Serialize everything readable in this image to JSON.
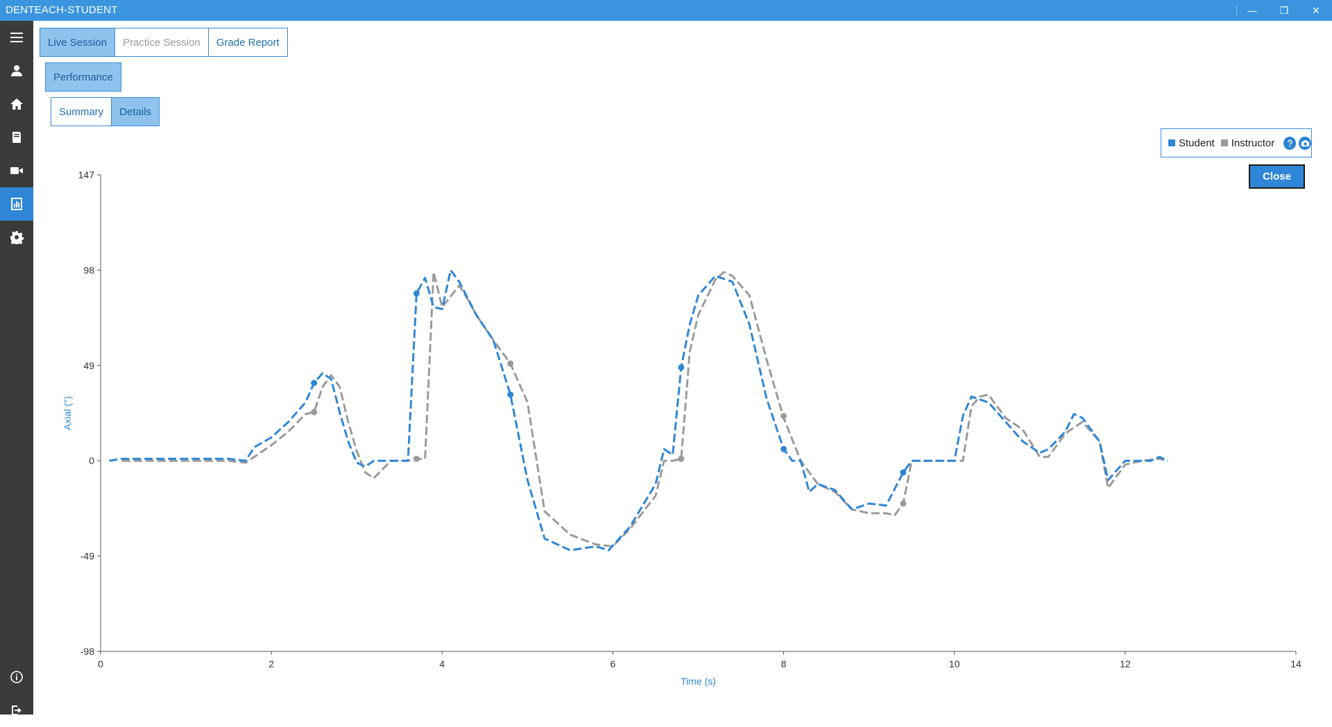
{
  "window": {
    "title": "DENTEACH-STUDENT",
    "minimize_glyph": "—",
    "restore_glyph": "❐",
    "close_glyph": "✕"
  },
  "sidebar": {
    "items": [
      {
        "icon": "hamburger-menu-icon",
        "active": false
      },
      {
        "icon": "user-icon",
        "active": false
      },
      {
        "icon": "home-icon",
        "active": false
      },
      {
        "icon": "book-icon",
        "active": false
      },
      {
        "icon": "video-camera-icon",
        "active": false
      },
      {
        "icon": "bar-chart-icon",
        "active": true
      },
      {
        "icon": "gear-icon",
        "active": false
      }
    ],
    "bottom": [
      {
        "icon": "info-icon"
      },
      {
        "icon": "logout-icon"
      }
    ]
  },
  "tabs": {
    "mode": [
      "Live Session",
      "Practice Session",
      "Grade Report"
    ],
    "mode_selected": "Live Session",
    "performance": "Performance",
    "view": [
      "Summary",
      "Details"
    ],
    "view_selected": "Details"
  },
  "legend": {
    "student": "Student",
    "instructor": "Instructor"
  },
  "close_label": "Close",
  "colors": {
    "accent": "#2f86d6",
    "student": "#2f86d6",
    "instructor": "#9a9a9a",
    "titlebar": "#3a95de",
    "sidebar": "#3b3b3b"
  },
  "chart_data": {
    "type": "line",
    "xlabel": "Time (s)",
    "ylabel": "Axial (°)",
    "xlim": [
      0,
      14
    ],
    "ylim": [
      -98,
      147
    ],
    "xticks": [
      0,
      2,
      4,
      6,
      8,
      10,
      12,
      14
    ],
    "yticks": [
      -98,
      -49,
      0,
      49,
      98,
      147
    ],
    "legend_position": "top-right",
    "series": [
      {
        "name": "Student",
        "color": "#2f86d6",
        "dashed": true,
        "x": [
          0.1,
          0.25,
          0.5,
          1.0,
          1.5,
          1.7,
          1.8,
          2.0,
          2.2,
          2.4,
          2.5,
          2.6,
          2.7,
          2.8,
          2.9,
          3.0,
          3.1,
          3.2,
          3.4,
          3.6,
          3.7,
          3.8,
          3.9,
          4.0,
          4.1,
          4.2,
          4.4,
          4.6,
          4.8,
          5.0,
          5.2,
          5.5,
          5.8,
          5.95,
          6.2,
          6.5,
          6.6,
          6.7,
          6.8,
          6.9,
          7.0,
          7.2,
          7.4,
          7.6,
          7.8,
          8.0,
          8.1,
          8.2,
          8.3,
          8.4,
          8.6,
          8.8,
          9.0,
          9.2,
          9.4,
          9.5,
          9.7,
          9.9,
          10.0,
          10.1,
          10.2,
          10.4,
          10.6,
          10.8,
          11.0,
          11.1,
          11.3,
          11.4,
          11.5,
          11.7,
          11.8,
          12.0,
          12.2,
          12.3,
          12.4,
          12.5
        ],
        "y": [
          0,
          1,
          1,
          1,
          1,
          0,
          7,
          12,
          20,
          30,
          40,
          45,
          42,
          25,
          10,
          -1,
          -3,
          0,
          0,
          0,
          86,
          94,
          79,
          78,
          98,
          92,
          75,
          62,
          34,
          -10,
          -40,
          -46,
          -44,
          -46,
          -34,
          -12,
          6,
          3,
          48,
          70,
          85,
          95,
          92,
          70,
          32,
          6,
          0,
          0,
          -16,
          -12,
          -15,
          -25,
          -22,
          -23,
          -6,
          0,
          0,
          0,
          0,
          23,
          33,
          30,
          20,
          10,
          4,
          6,
          15,
          24,
          22,
          10,
          -10,
          0,
          0,
          0,
          2,
          0
        ]
      },
      {
        "name": "Instructor",
        "color": "#9a9a9a",
        "dashed": true,
        "x": [
          0.25,
          0.5,
          1.0,
          1.5,
          1.7,
          1.8,
          2.0,
          2.2,
          2.4,
          2.5,
          2.6,
          2.7,
          2.8,
          2.9,
          3.0,
          3.1,
          3.2,
          3.4,
          3.6,
          3.7,
          3.8,
          3.9,
          4.0,
          4.2,
          4.3,
          4.4,
          4.6,
          4.8,
          5.0,
          5.2,
          5.5,
          5.8,
          6.0,
          6.2,
          6.5,
          6.6,
          6.7,
          6.8,
          6.9,
          7.0,
          7.2,
          7.3,
          7.4,
          7.6,
          7.8,
          8.0,
          8.2,
          8.4,
          8.6,
          8.8,
          9.0,
          9.2,
          9.3,
          9.4,
          9.5,
          9.7,
          9.9,
          10.1,
          10.2,
          10.3,
          10.4,
          10.6,
          10.8,
          11.0,
          11.1,
          11.3,
          11.5,
          11.7,
          11.8,
          12.0,
          12.2,
          12.4,
          12.5
        ],
        "y": [
          0,
          0,
          0,
          0,
          -1,
          2,
          8,
          15,
          24,
          25,
          38,
          44,
          38,
          20,
          5,
          -6,
          -9,
          0,
          0,
          1,
          1,
          97,
          79,
          90,
          83,
          75,
          62,
          50,
          30,
          -26,
          -38,
          -43,
          -44,
          -35,
          -18,
          0,
          0,
          1,
          56,
          75,
          93,
          97,
          95,
          85,
          52,
          22,
          0,
          -12,
          -16,
          -25,
          -27,
          -27,
          -28,
          -22,
          0,
          0,
          0,
          0,
          28,
          33,
          34,
          22,
          16,
          2,
          2,
          14,
          20,
          10,
          -14,
          -2,
          0,
          1,
          0
        ]
      }
    ],
    "markers": {
      "Student": [
        [
          2.5,
          40
        ],
        [
          3.7,
          86
        ],
        [
          4.8,
          34
        ],
        [
          6.8,
          48
        ],
        [
          8.0,
          6
        ],
        [
          9.4,
          -6
        ]
      ],
      "Instructor": [
        [
          2.5,
          25
        ],
        [
          3.7,
          1
        ],
        [
          4.8,
          50
        ],
        [
          6.8,
          1
        ],
        [
          8.0,
          23
        ],
        [
          9.4,
          -22
        ]
      ]
    }
  }
}
